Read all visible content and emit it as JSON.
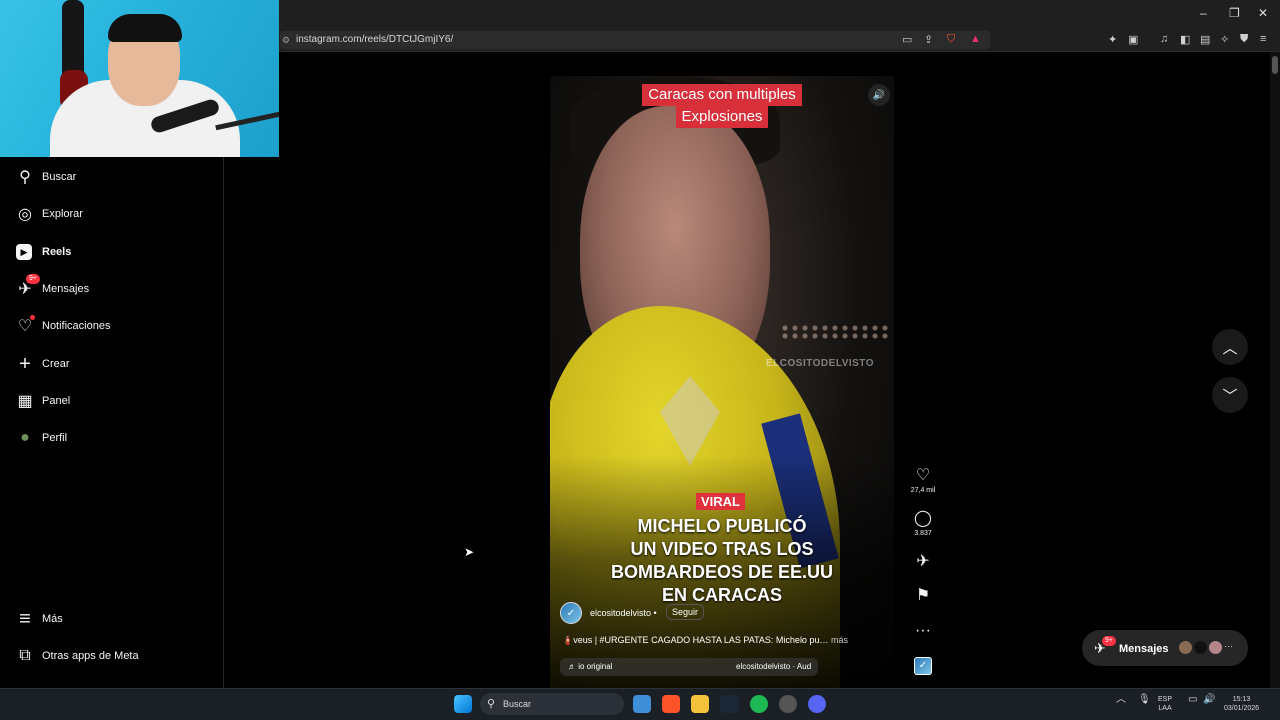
{
  "browser": {
    "url": "instagram.com/reels/DTCtJGmjIY6/",
    "window_controls": {
      "minimize": "–",
      "restore": "❐",
      "close": "✕"
    }
  },
  "sidebar": {
    "items": [
      {
        "label": "Buscar",
        "icon": "search-icon",
        "glyph": "⚲"
      },
      {
        "label": "Explorar",
        "icon": "compass-icon",
        "glyph": "◎"
      },
      {
        "label": "Reels",
        "icon": "reels-icon",
        "glyph": "▶",
        "active": true
      },
      {
        "label": "Mensajes",
        "icon": "messenger-icon",
        "glyph": "✈",
        "badge": "9+"
      },
      {
        "label": "Notificaciones",
        "icon": "heart-icon",
        "glyph": "♡",
        "dot": true
      },
      {
        "label": "Crear",
        "icon": "plus-icon",
        "glyph": "+"
      },
      {
        "label": "Panel",
        "icon": "chart-icon",
        "glyph": "▦"
      },
      {
        "label": "Perfil",
        "icon": "profile-avatar-icon",
        "glyph": "●"
      }
    ],
    "bottom": [
      {
        "label": "Más",
        "icon": "menu-icon",
        "glyph": "≡"
      },
      {
        "label": "Otras apps de Meta",
        "icon": "meta-apps-icon",
        "glyph": "⧉"
      }
    ]
  },
  "reel": {
    "overlay_title_line1": "Caracas con multiples",
    "overlay_title_line2": "Explosiones",
    "watermark": "ELCOSITODELVISTO",
    "tag": "VIRAL",
    "headline_line1": "MICHELO PUBLICÓ",
    "headline_line2": "UN VIDEO TRAS LOS",
    "headline_line3": "BOMBARDEOS DE EE.UU",
    "headline_line4": "EN CARACAS",
    "username": "elcositodelvisto",
    "follow_label": "Seguir",
    "caption": "🧯veus | #URGENTE CAGADO HASTA LAS PATAS: Michelo pu…",
    "caption_more": "más",
    "audio_left": "♬ io original",
    "audio_right": "elcositodelvisto · Aud"
  },
  "actions": {
    "likes": "27,4 mil",
    "comments": "3.837"
  },
  "messages_pill": {
    "label": "Mensajes",
    "badge": "9+",
    "more": "···"
  },
  "taskbar": {
    "search_placeholder": "Buscar",
    "lang_line1": "ESP",
    "lang_line2": "LAA",
    "time": "15:13",
    "date": "03/01/2026"
  },
  "colors": {
    "accent_red": "#ff3040",
    "reel_title_bg": "#d7303b",
    "background": "#000000"
  }
}
